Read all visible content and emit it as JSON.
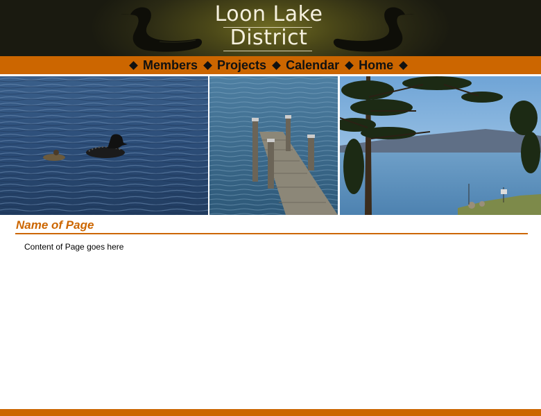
{
  "header": {
    "title_line1": "Loon Lake",
    "title_line2": "District"
  },
  "nav": {
    "items": [
      {
        "label": "Members"
      },
      {
        "label": "Projects"
      },
      {
        "label": "Calendar"
      },
      {
        "label": "Home"
      }
    ]
  },
  "photos": [
    {
      "subject": "loons-swimming-on-lake"
    },
    {
      "subject": "wooden-dock-in-water"
    },
    {
      "subject": "pine-tree-lake-view"
    }
  ],
  "main": {
    "page_title": "Name of Page",
    "content": "Content of Page goes here"
  },
  "colors": {
    "accent": "#cc6600",
    "header_dark": "#1a1a10",
    "title_text": "#f6f1df"
  }
}
